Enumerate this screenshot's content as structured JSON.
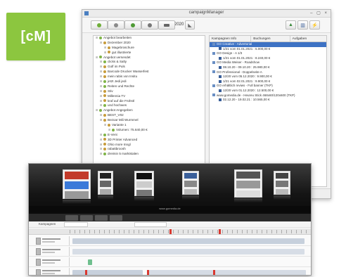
{
  "logo": {
    "text": "[cM]",
    "color": "#8cc63f"
  },
  "window": {
    "title": "campaignManager",
    "controls": "– ▢ ×",
    "toolbar": {
      "year": "2020",
      "buttons": [
        {
          "icon": "circle-green-icon",
          "color": "#6fae3a"
        },
        {
          "icon": "circle-gray-icon",
          "color": "#8a8a8a"
        },
        {
          "icon": "circle-green-icon",
          "color": "#4f9a35"
        },
        {
          "icon": "shape-gray-icon",
          "color": "#777777"
        },
        {
          "icon": "gauge-icon",
          "color": "#666666"
        }
      ],
      "right_buttons": [
        "export-icon",
        "chart-icon",
        "graph-icon"
      ]
    },
    "tree": [
      "Angebot bearbeiten",
      "Dezember 2020",
      "Magebroschure",
      "gut illustrierte",
      "Angebot versendet",
      "clicks & Salty",
      "Golf im Puls",
      "Barcode Drucker Wasserfest",
      "mein rabis von Insitu",
      "jetzt Jedi jedi",
      "Reiten und Rechte",
      "Stiv",
      "Millennia TV",
      "kraf auf die Frühstl",
      "und hochwes",
      "Angebot Angegeben",
      "BEST_V02",
      "Bezoar Mili Wurmmel",
      "Variante 1",
      "Volumen: 75.640,00 €",
      "E-Vent",
      "3D Printer Advanced",
      "Ohio more Inngl",
      "rabattbroosh",
      "dreimin 5 marktstalen"
    ],
    "columns": [
      "Kampagnen Info",
      "Buchungen",
      "Aufgaben"
    ],
    "bookings": [
      "GO Creative - Advertorial",
      "1/21 vom 01.01.2021 : 5.000,00 €",
      "GO Design - A 1/3",
      "1/21 vom 01.01.2021 : 8.240,00 €",
      "GO Media Weiser - Roadshow",
      "08.10.20 - 09.10.20 : 25.980,00 €",
      "GO Professional - Doppelseite A",
      "12/20 vom 05.12.2020 : 9.900,00 €",
      "1/21 vom 02.01.2021 : 9.900,00 €",
      "GO erhältlich reviws - Full banner (TKP)",
      "12/20 vom 01.12.2020 : 12.500,00 €",
      "www.gomedia.de - Heureu Stick 468x60/120x600 (TKP)",
      "02.12.20 - 19.02.21 : 10.565,00 €"
    ]
  },
  "gallery": {
    "label": "www.gomedia.de",
    "search_label": "Kampagnen"
  }
}
